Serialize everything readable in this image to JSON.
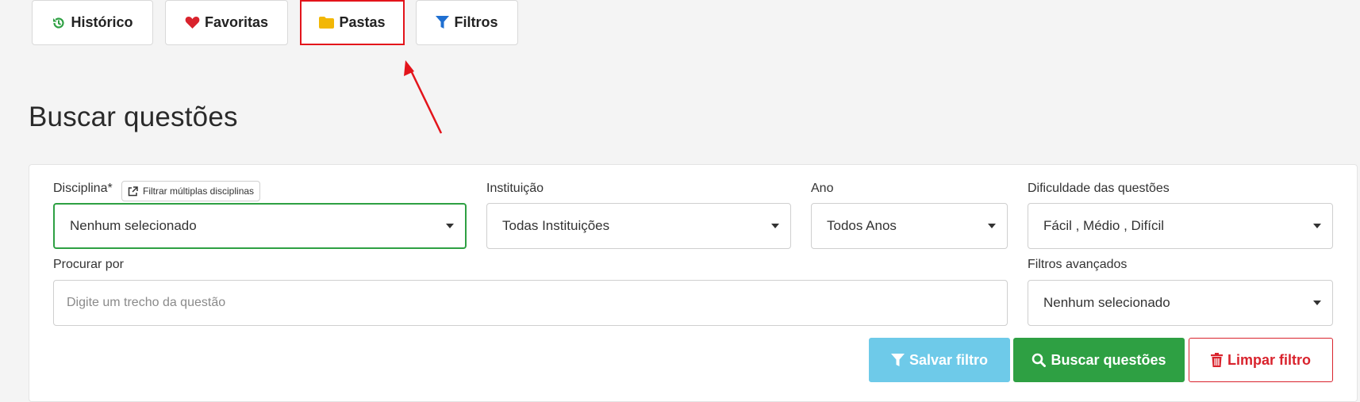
{
  "tabs": [
    {
      "label": "Histórico",
      "icon": "history-icon",
      "color": "#2ea043"
    },
    {
      "label": "Favoritas",
      "icon": "heart-icon",
      "color": "#d9232d"
    },
    {
      "label": "Pastas",
      "icon": "folder-icon",
      "color": "#f2b705"
    },
    {
      "label": "Filtros",
      "icon": "filter-icon",
      "color": "#1f6fd1"
    }
  ],
  "page_title": "Buscar questões",
  "filters": {
    "disciplina": {
      "label": "Disciplina*",
      "multi_button": "Filtrar múltiplas disciplinas",
      "value": "Nenhum selecionado"
    },
    "instituicao": {
      "label": "Instituição",
      "value": "Todas Instituições"
    },
    "ano": {
      "label": "Ano",
      "value": "Todos Anos"
    },
    "dificuldade": {
      "label": "Dificuldade das questões",
      "value": "Fácil , Médio , Difícil"
    },
    "procurar": {
      "label": "Procurar por",
      "placeholder": "Digite um trecho da questão"
    },
    "avancados": {
      "label": "Filtros avançados",
      "value": "Nenhum selecionado"
    }
  },
  "actions": {
    "save": "Salvar filtro",
    "search": "Buscar questões",
    "clear": "Limpar filtro"
  },
  "colors": {
    "highlight": "#e3141b",
    "primary_green": "#2ea043",
    "info_blue": "#6ecae9",
    "danger_red": "#d9232d"
  }
}
